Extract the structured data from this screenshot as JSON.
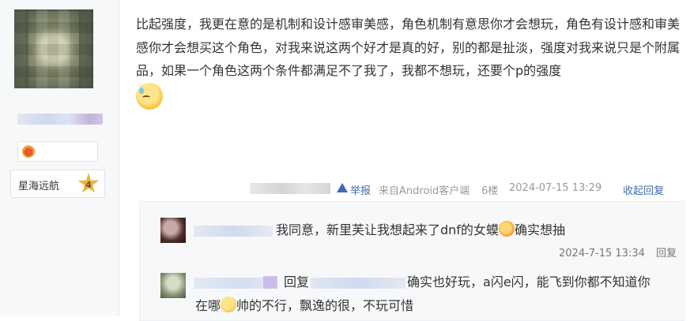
{
  "user": {
    "level_name": "星海远航",
    "level_num": "4"
  },
  "post": {
    "text": "比起强度，我更在意的是机制和设计感审美感，角色机制有意思你才会想玩，角色有设计感和审美感你才会想买这个角色，对我来说这两个好才是真的好，别的都是扯淡，强度对我来说只是个附属品，如果一个角色这两个条件都满足不了我了，我都不想玩，还要个p的强度",
    "footer": {
      "report": "举报",
      "client": "来自Android客户端",
      "floor": "6楼",
      "time": "2024-07-15 13:29",
      "collapse": "收起回复"
    }
  },
  "replies": {
    "r1": {
      "text_a": "我同意，新里芙让我想起来了dnf的女蟆",
      "text_b": "确实想抽",
      "time": "2024-7-15 13:34",
      "reply_label": "回复"
    },
    "r2": {
      "reply_word": "回复",
      "text_a": "确实也好玩，a闪e闪，能飞到你都不知道你",
      "text_b": "在哪",
      "text_c": "帅的不行，飘逸的很，不玩可惜"
    }
  },
  "icons": {
    "badge": "flame-badge-icon",
    "level_star": "star-icon",
    "report": "warning-icon",
    "emoji_sweat": "sweat-emoji-icon",
    "emoji_love": "heart-eyes-emoji-icon",
    "emoji_smile": "smile-emoji-icon"
  },
  "colors": {
    "link": "#3f6bb3",
    "meta": "#999999",
    "reply_bg": "#f7f8fa"
  }
}
